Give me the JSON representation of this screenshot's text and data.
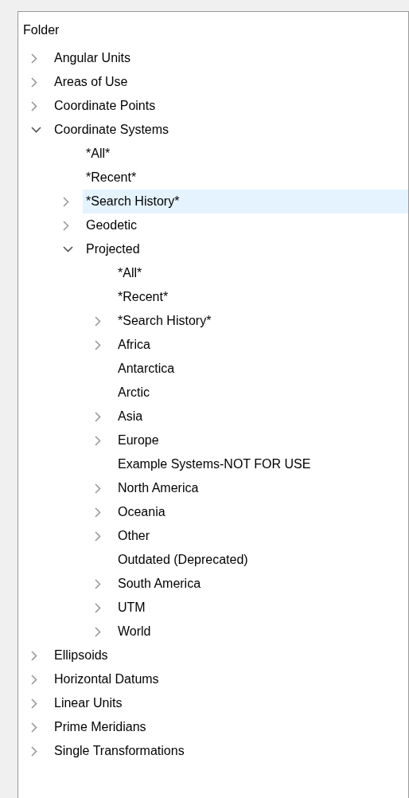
{
  "panel": {
    "header": "Folder"
  },
  "tree": [
    {
      "label": "Angular Units",
      "expanded": false,
      "selected": false
    },
    {
      "label": "Areas of Use",
      "expanded": false,
      "selected": false
    },
    {
      "label": "Coordinate Points",
      "expanded": false,
      "selected": false
    },
    {
      "label": "Coordinate Systems",
      "expanded": true,
      "selected": false,
      "children": [
        {
          "label": "*All*",
          "selected": false
        },
        {
          "label": "*Recent*",
          "selected": false
        },
        {
          "label": "*Search History*",
          "expanded": false,
          "selected": true
        },
        {
          "label": "Geodetic",
          "expanded": false,
          "selected": false
        },
        {
          "label": "Projected",
          "expanded": true,
          "selected": false,
          "children": [
            {
              "label": "*All*",
              "selected": false
            },
            {
              "label": "*Recent*",
              "selected": false
            },
            {
              "label": "*Search History*",
              "expanded": false,
              "selected": false
            },
            {
              "label": "Africa",
              "expanded": false,
              "selected": false
            },
            {
              "label": "Antarctica",
              "selected": false
            },
            {
              "label": "Arctic",
              "selected": false
            },
            {
              "label": "Asia",
              "expanded": false,
              "selected": false
            },
            {
              "label": "Europe",
              "expanded": false,
              "selected": false
            },
            {
              "label": "Example Systems-NOT FOR USE",
              "selected": false
            },
            {
              "label": "North America",
              "expanded": false,
              "selected": false
            },
            {
              "label": "Oceania",
              "expanded": false,
              "selected": false
            },
            {
              "label": "Other",
              "expanded": false,
              "selected": false
            },
            {
              "label": "Outdated (Deprecated)",
              "selected": false
            },
            {
              "label": "South America",
              "expanded": false,
              "selected": false
            },
            {
              "label": "UTM",
              "expanded": false,
              "selected": false
            },
            {
              "label": "World",
              "expanded": false,
              "selected": false
            }
          ]
        }
      ]
    },
    {
      "label": "Ellipsoids",
      "expanded": false,
      "selected": false
    },
    {
      "label": "Horizontal Datums",
      "expanded": false,
      "selected": false
    },
    {
      "label": "Linear Units",
      "expanded": false,
      "selected": false
    },
    {
      "label": "Prime Meridians",
      "expanded": false,
      "selected": false
    },
    {
      "label": "Single Transformations",
      "expanded": false,
      "selected": false
    }
  ]
}
